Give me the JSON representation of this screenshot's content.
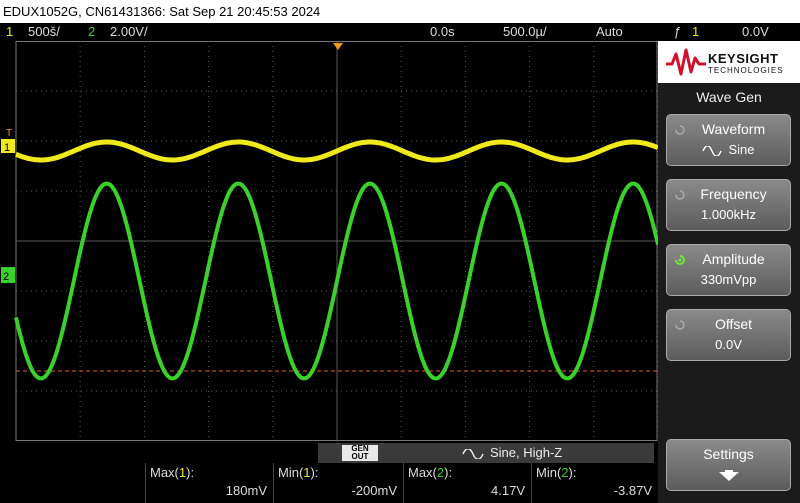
{
  "title_bar": {
    "text": "EDUX1052G, CN61431366: Sat Sep 21 20:45:53 2024"
  },
  "status_bar": {
    "ch1_num": "1",
    "ch1_scale": "500š/",
    "ch2_num": "2",
    "ch2_scale": "2.00V/",
    "time_delay": "0.0s",
    "time_scale": "500.0µ/",
    "trigger_mode": "Auto",
    "trigger_icon": "ƒ",
    "trigger_ch": "1",
    "trigger_level": "0.0V"
  },
  "screen": {
    "ch1_marker": "1",
    "ch2_marker": "2",
    "trigger_marker": "T",
    "colors": {
      "ch1": "#f0e91c",
      "ch2": "#39d12a",
      "grid": "#5a5a5a",
      "ref_line": "#e05a3a"
    },
    "waveforms": {
      "ch1": {
        "center_div": -1.8,
        "amp_div": 0.18,
        "period_div": 2.05,
        "phase_div": 0.9
      },
      "ch2": {
        "center_div": 0.8,
        "amp_div": 1.95,
        "period_div": 2.05,
        "phase_div": 0.9
      }
    }
  },
  "generator": {
    "out_label_1": "GEN",
    "out_label_2": "OUT",
    "description": "Sine, High-Z"
  },
  "measurements": [
    {
      "label_pre": "Max(",
      "ch": "1",
      "label_post": "):",
      "value": "180mV",
      "color": "#f0e91c"
    },
    {
      "label_pre": "Min(",
      "ch": "1",
      "label_post": "):",
      "value": "-200mV",
      "color": "#f0e91c"
    },
    {
      "label_pre": "Max(",
      "ch": "2",
      "label_post": "):",
      "value": "4.17V",
      "color": "#39d12a"
    },
    {
      "label_pre": "Min(",
      "ch": "2",
      "label_post": "):",
      "value": "-3.87V",
      "color": "#39d12a"
    }
  ],
  "panel": {
    "brand": "KEYSIGHT",
    "brand_sub": "TECHNOLOGIES",
    "menu_title": "Wave Gen",
    "softkeys": [
      {
        "label": "Waveform",
        "value": "Sine"
      },
      {
        "label": "Frequency",
        "value": "1.000kHz"
      },
      {
        "label": "Amplitude",
        "value": "330mVpp"
      },
      {
        "label": "Offset",
        "value": "0.0V"
      }
    ],
    "settings_label": "Settings"
  }
}
